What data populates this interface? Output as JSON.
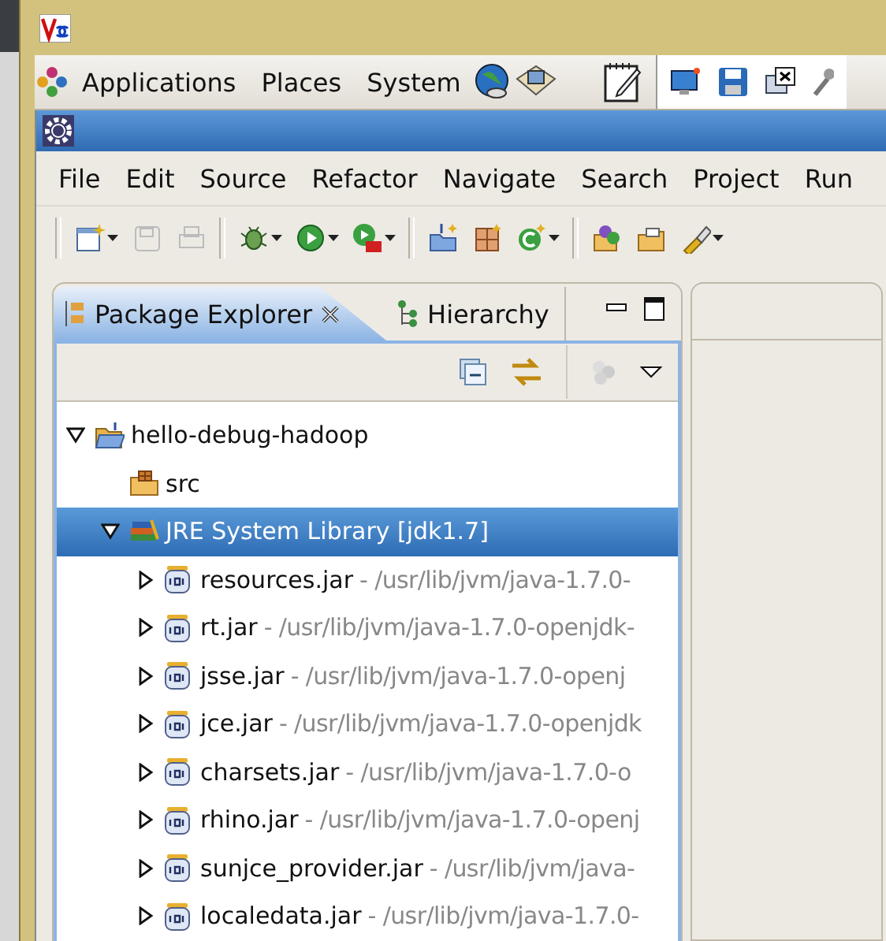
{
  "desktop_panel": {
    "menus": [
      "Applications",
      "Places",
      "System"
    ]
  },
  "menubar": {
    "items": [
      {
        "label": "File"
      },
      {
        "label": "Edit"
      },
      {
        "label": "Source"
      },
      {
        "label": "Refactor"
      },
      {
        "label": "Navigate"
      },
      {
        "label": "Search"
      },
      {
        "label": "Project"
      },
      {
        "label": "Run"
      }
    ]
  },
  "view": {
    "tabs": [
      {
        "label": "Package Explorer",
        "selected": true,
        "closable": true
      },
      {
        "label": "Hierarchy",
        "selected": false,
        "closable": false
      }
    ]
  },
  "tree": [
    {
      "label": "hello-debug-hadoop",
      "kind": "project",
      "expanded": true,
      "selected": false,
      "children": [
        {
          "label": "src",
          "kind": "source-folder",
          "selected": false
        },
        {
          "label": "JRE System Library [jdk1.7]",
          "kind": "library",
          "expanded": true,
          "selected": true,
          "children": [
            {
              "label": "resources.jar",
              "detail": "- /usr/lib/jvm/java-1.7.0-",
              "kind": "jar",
              "expanded": false,
              "selected": false
            },
            {
              "label": "rt.jar",
              "detail": "- /usr/lib/jvm/java-1.7.0-openjdk-",
              "kind": "jar",
              "expanded": false,
              "selected": false
            },
            {
              "label": "jsse.jar",
              "detail": "- /usr/lib/jvm/java-1.7.0-openj",
              "kind": "jar",
              "expanded": false,
              "selected": false
            },
            {
              "label": "jce.jar",
              "detail": "- /usr/lib/jvm/java-1.7.0-openjdk",
              "kind": "jar",
              "expanded": false,
              "selected": false
            },
            {
              "label": "charsets.jar",
              "detail": "- /usr/lib/jvm/java-1.7.0-o",
              "kind": "jar",
              "expanded": false,
              "selected": false
            },
            {
              "label": "rhino.jar",
              "detail": "- /usr/lib/jvm/java-1.7.0-openj",
              "kind": "jar",
              "expanded": false,
              "selected": false
            },
            {
              "label": "sunjce_provider.jar",
              "detail": "- /usr/lib/jvm/java-",
              "kind": "jar",
              "expanded": false,
              "selected": false
            },
            {
              "label": "localedata.jar",
              "detail": "- /usr/lib/jvm/java-1.7.0-",
              "kind": "jar",
              "expanded": false,
              "selected": false
            }
          ]
        }
      ]
    }
  ]
}
